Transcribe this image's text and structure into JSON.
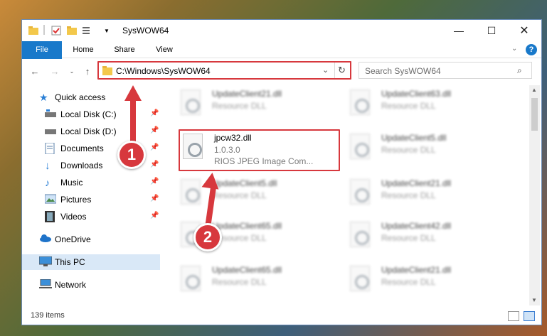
{
  "window": {
    "title": "SysWOW64"
  },
  "ribbon": {
    "tabs": [
      "File",
      "Home",
      "Share",
      "View"
    ]
  },
  "address": {
    "path": "C:\\Windows\\SysWOW64"
  },
  "search": {
    "placeholder": "Search SysWOW64"
  },
  "sidebar": {
    "quick_access": "Quick access",
    "items": [
      "Local Disk (C:)",
      "Local Disk (D:)",
      "Documents",
      "Downloads",
      "Music",
      "Pictures",
      "Videos"
    ],
    "onedrive": "OneDrive",
    "this_pc": "This PC",
    "network": "Network"
  },
  "files": {
    "highlighted": {
      "name": "jpcw32.dll",
      "version": "1.0.3.0",
      "desc": "RIOS JPEG Image Com..."
    },
    "left": [
      {
        "name": "UpdateClient21.dll",
        "sub": "Resource DLL"
      },
      {
        "name": "UpdateClient5.dll",
        "sub": "Resource DLL"
      },
      {
        "name": "UpdateClient65.dll",
        "sub": "Resource DLL"
      },
      {
        "name": "UpdateClient65.dll",
        "sub": "Resource DLL"
      }
    ],
    "right": [
      {
        "name": "UpdateClient63.dll",
        "sub": "Resource DLL"
      },
      {
        "name": "UpdateClient5.dll",
        "sub": "Resource DLL"
      },
      {
        "name": "UpdateClient21.dll",
        "sub": "Resource DLL"
      },
      {
        "name": "UpdateClient42.dll",
        "sub": "Resource DLL"
      },
      {
        "name": "UpdateClient21.dll",
        "sub": "Resource DLL"
      }
    ]
  },
  "status": {
    "count": "139 items"
  },
  "annotations": {
    "step1": "1",
    "step2": "2",
    "color": "#d7383d"
  }
}
